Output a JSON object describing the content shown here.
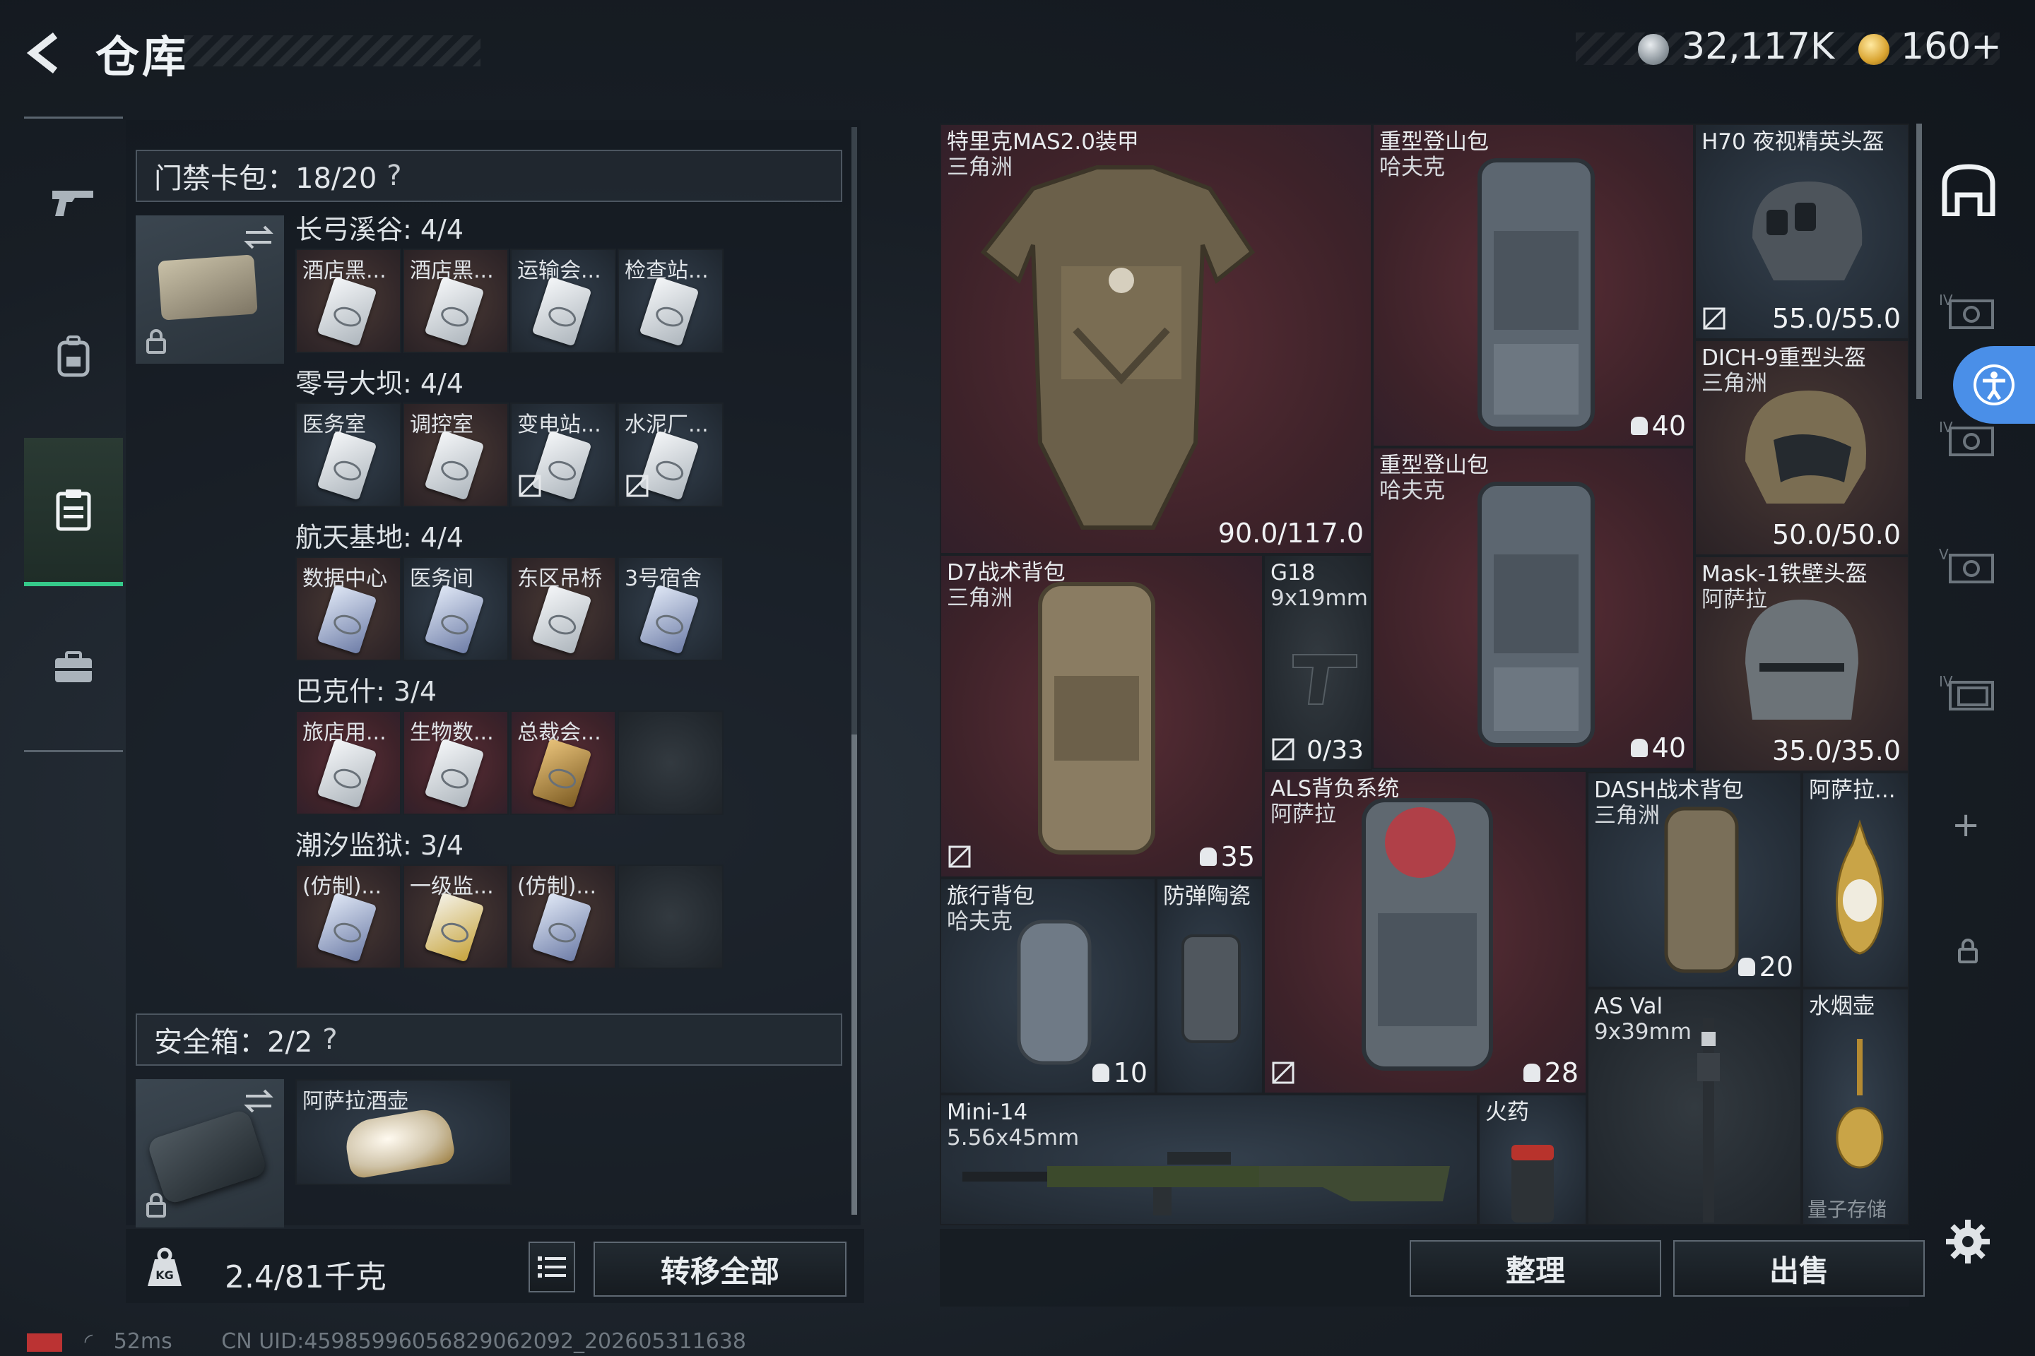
{
  "header": {
    "title": "仓库",
    "currency_main": "32,117K",
    "currency_premium": "160+"
  },
  "keycard_bag": {
    "header": "门禁卡包：18/20",
    "help": "?",
    "groups": [
      {
        "name": "长弓溪谷: 4/4",
        "slots": [
          "酒店黑...",
          "酒店黑...",
          "运输会...",
          "检查站..."
        ]
      },
      {
        "name": "零号大坝: 4/4",
        "slots": [
          "医务室",
          "调控室",
          "变电站...",
          "水泥厂..."
        ]
      },
      {
        "name": "航天基地: 4/4",
        "slots": [
          "数据中心",
          "医务间",
          "东区吊桥",
          "3号宿舍"
        ]
      },
      {
        "name": "巴克什: 3/4",
        "slots": [
          "旅店用...",
          "生物数...",
          "总裁会...",
          ""
        ]
      },
      {
        "name": "潮汐监狱: 3/4",
        "slots": [
          "(仿制)...",
          "一级监...",
          "(仿制)...",
          ""
        ]
      }
    ]
  },
  "safe_box": {
    "header": "安全箱：2/2",
    "help": "?",
    "item": "阿萨拉酒壶"
  },
  "footer": {
    "weight": "2.4/81千克",
    "transfer_all": "转移全部",
    "sort": "整理",
    "sell": "出售"
  },
  "items": {
    "armor": {
      "name": "特里克MAS2.0装甲",
      "sub": "三角洲",
      "durability": "90.0/117.0"
    },
    "heavy_pack1": {
      "name": "重型登山包",
      "sub": "哈夫克",
      "capacity": "40"
    },
    "h70": {
      "name": "H70 夜视精英头盔",
      "durability": "55.0/55.0"
    },
    "dich9": {
      "name": "DICH-9重型头盔",
      "sub": "三角洲",
      "durability": "50.0/50.0"
    },
    "heavy_pack2": {
      "name": "重型登山包",
      "sub": "哈夫克",
      "capacity": "40"
    },
    "d7": {
      "name": "D7战术背包",
      "sub": "三角洲",
      "capacity": "35"
    },
    "g18": {
      "name": "G18",
      "sub": "9x19mm",
      "ammo": "0/33"
    },
    "mask1": {
      "name": "Mask-1铁壁头盔",
      "sub": "阿萨拉",
      "durability": "35.0/35.0"
    },
    "als": {
      "name": "ALS背负系统",
      "sub": "阿萨拉",
      "capacity": "28"
    },
    "dash": {
      "name": "DASH战术背包",
      "sub": "三角洲",
      "capacity": "20"
    },
    "asala_pot": {
      "name": "阿萨拉..."
    },
    "travel_pack": {
      "name": "旅行背包",
      "sub": "哈夫克",
      "capacity": "10"
    },
    "ceramic": {
      "name": "防弹陶瓷"
    },
    "asval": {
      "name": "AS Val",
      "sub": "9x39mm"
    },
    "hookah": {
      "name": "水烟壶",
      "extra": "量子存储"
    },
    "mini14": {
      "name": "Mini-14",
      "sub": "5.56x45mm"
    },
    "gunpowder": {
      "name": "火药"
    }
  },
  "status": {
    "ping": "52ms",
    "uid": "CN UID:4598599605682906209​2_202605311638"
  },
  "icons": {
    "back": "back-arrow-icon",
    "coin_silver": "silver-coin-icon",
    "coin_gold": "gold-coin-icon",
    "weight": "weight-icon",
    "no_sale": "no-sale-icon",
    "gear": "gear-icon"
  }
}
